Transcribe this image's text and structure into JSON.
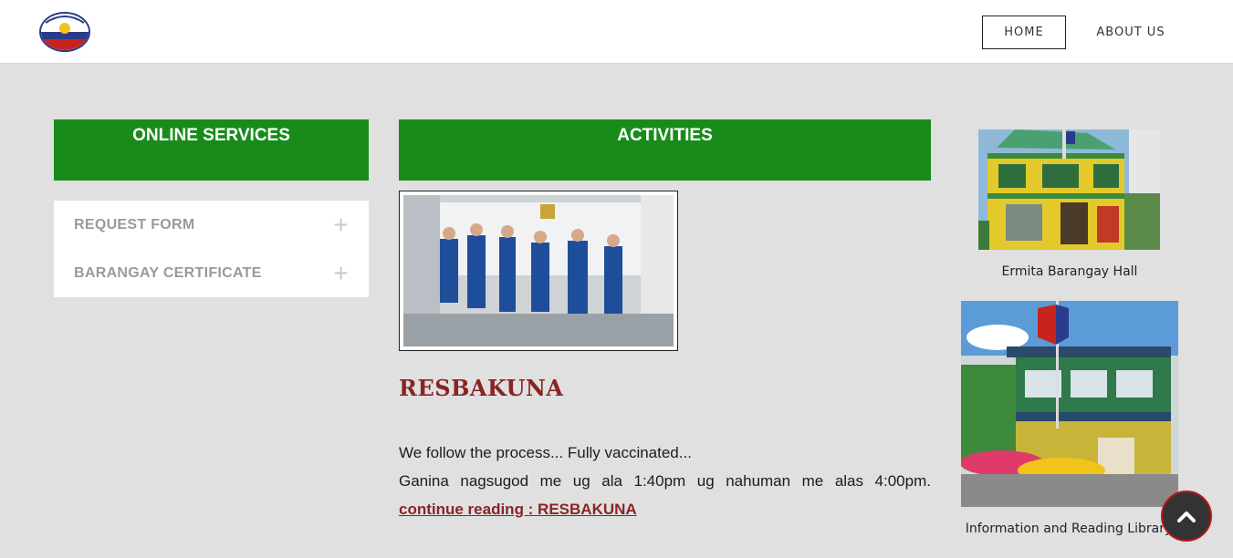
{
  "header": {
    "logo_icon": "barangay-seal-logo",
    "nav": {
      "home": "HOME",
      "about": "ABOUT US"
    }
  },
  "services": {
    "title": "ONLINE SERVICES",
    "items": [
      {
        "label": "REQUEST FORM",
        "icon": "plus-icon"
      },
      {
        "label": "BARANGAY CERTIFICATE",
        "icon": "plus-icon"
      }
    ]
  },
  "activities": {
    "title": "ACTIVITIES",
    "post": {
      "title": "RESBAKUNA",
      "text_line1": "We follow the process... Fully vaccinated...",
      "text_line2_words": [
        "Ganina",
        "nagsugod",
        "me",
        "ug",
        "ala",
        "1:40pm",
        "ug",
        "nahuman",
        "me",
        "alas",
        "4:00pm."
      ],
      "link": "continue reading : RESBAKUNA"
    }
  },
  "sidebar": {
    "hall_caption": "Ermita Barangay Hall",
    "library_caption": "Information and Reading Library"
  },
  "colors": {
    "green": "#198b1b",
    "maroon": "#8a2424"
  },
  "scroll_icon": "chevron-up-icon"
}
